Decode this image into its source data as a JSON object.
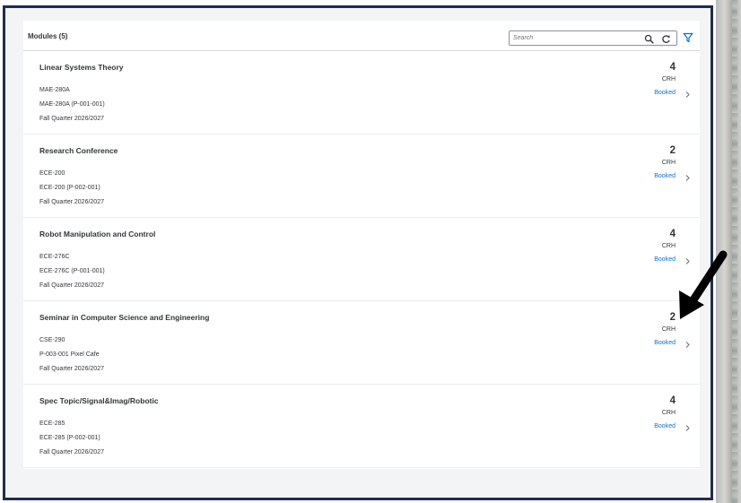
{
  "header": {
    "title": "Modules (5)",
    "search_placeholder": "Search"
  },
  "modules": [
    {
      "title": "Linear Systems Theory",
      "code": "MAE-280A",
      "section": "MAE-280A (P-001-001)",
      "term": "Fall Quarter 2026/2027",
      "credits": "4",
      "unit": "CRH",
      "status": "Booked"
    },
    {
      "title": "Research Conference",
      "code": "ECE-200",
      "section": "ECE-200 (P-002-001)",
      "term": "Fall Quarter 2026/2027",
      "credits": "2",
      "unit": "CRH",
      "status": "Booked"
    },
    {
      "title": "Robot Manipulation and Control",
      "code": "ECE-276C",
      "section": "ECE-276C (P-001-001)",
      "term": "Fall Quarter 2026/2027",
      "credits": "4",
      "unit": "CRH",
      "status": "Booked"
    },
    {
      "title": "Seminar in Computer Science and Engineering",
      "code": "CSE-290",
      "section": "P-003-001 Pixel Cafe",
      "term": "Fall Quarter 2026/2027",
      "credits": "2",
      "unit": "CRH",
      "status": "Booked"
    },
    {
      "title": "Spec Topic/Signal&Imag/Robotic",
      "code": "ECE-285",
      "section": "ECE-285 (P-002-001)",
      "term": "Fall Quarter 2026/2027",
      "credits": "4",
      "unit": "CRH",
      "status": "Booked"
    }
  ],
  "colors": {
    "frame_border": "#1f2d4f",
    "link": "#0a6ed1",
    "text": "#32363a",
    "annotation_arrow": "#000000"
  },
  "icons": [
    "search-icon",
    "refresh-icon",
    "filter-icon",
    "chevron-right-icon",
    "pointer-arrow-icon"
  ]
}
